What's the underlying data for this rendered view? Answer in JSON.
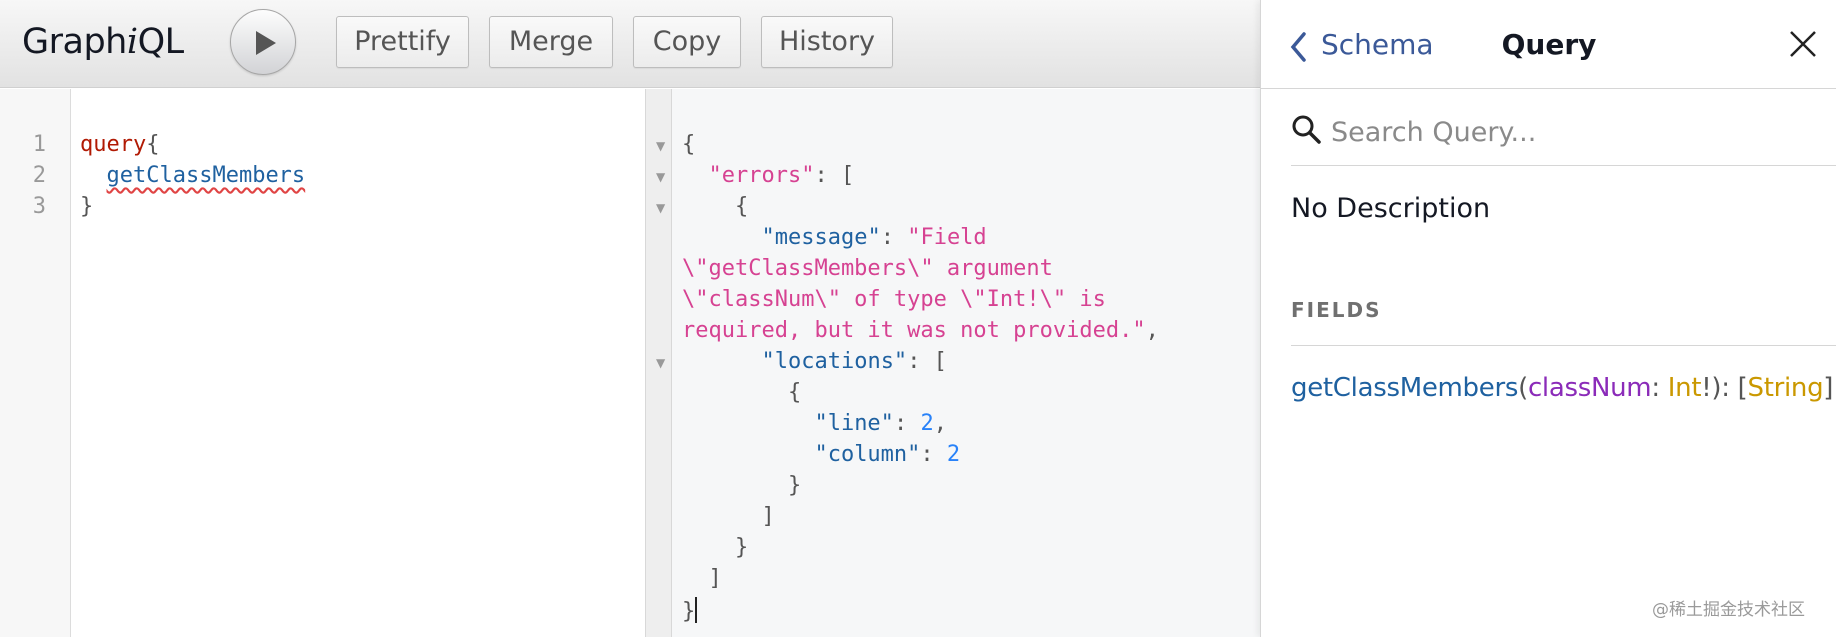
{
  "toolbar": {
    "logo_prefix": "Graph",
    "logo_italic": "i",
    "logo_suffix": "QL",
    "buttons": [
      "Prettify",
      "Merge",
      "Copy",
      "History"
    ]
  },
  "editor": {
    "line_numbers": [
      "1",
      "2",
      "3"
    ],
    "lines": [
      {
        "keyword": "query",
        "punct": "{"
      },
      {
        "indent": "  ",
        "field": "getClassMembers"
      },
      {
        "punct": "}"
      }
    ]
  },
  "result": {
    "l1": "{",
    "errors_key": "\"errors\"",
    "l2_tail": ": [",
    "l3": "{",
    "message_key": "\"message\"",
    "message_val_1": "\"Field",
    "message_val_2": "\\\"getClassMembers\\\" argument",
    "message_val_3": "\\\"classNum\\\" of type \\\"Int!\\\" is",
    "message_val_4": "required, but it was not provided.\"",
    "message_tail": ",",
    "locations_key": "\"locations\"",
    "locations_tail": ": [",
    "l10": "{",
    "line_key": "\"line\"",
    "line_val": "2",
    "column_key": "\"column\"",
    "column_val": "2",
    "l13": "}",
    "l14": "]",
    "l15": "}",
    "l16": "]",
    "l17": "}"
  },
  "docs": {
    "back_label": "Schema",
    "title": "Query",
    "search_placeholder": "Search Query...",
    "description": "No Description",
    "section_title": "FIELDS",
    "field": {
      "name": "getClassMembers",
      "open_paren": "(",
      "arg_name": "classNum",
      "colon": ": ",
      "arg_type": "Int",
      "bang": "!",
      "close": "): [",
      "return_type": "String",
      "close_bracket": "]"
    }
  },
  "watermark": "@稀土掘金技术社区",
  "colors": {
    "keyword": "#b11a04",
    "field": "#1f61a0",
    "error_string": "#d64292",
    "number": "#2882f9",
    "arg": "#8b2bb9",
    "type": "#ca9800",
    "back_link": "#3b5998"
  },
  "icons": [
    "play-icon",
    "chevron-left-icon",
    "close-icon",
    "search-icon",
    "fold-arrow-icon"
  ]
}
